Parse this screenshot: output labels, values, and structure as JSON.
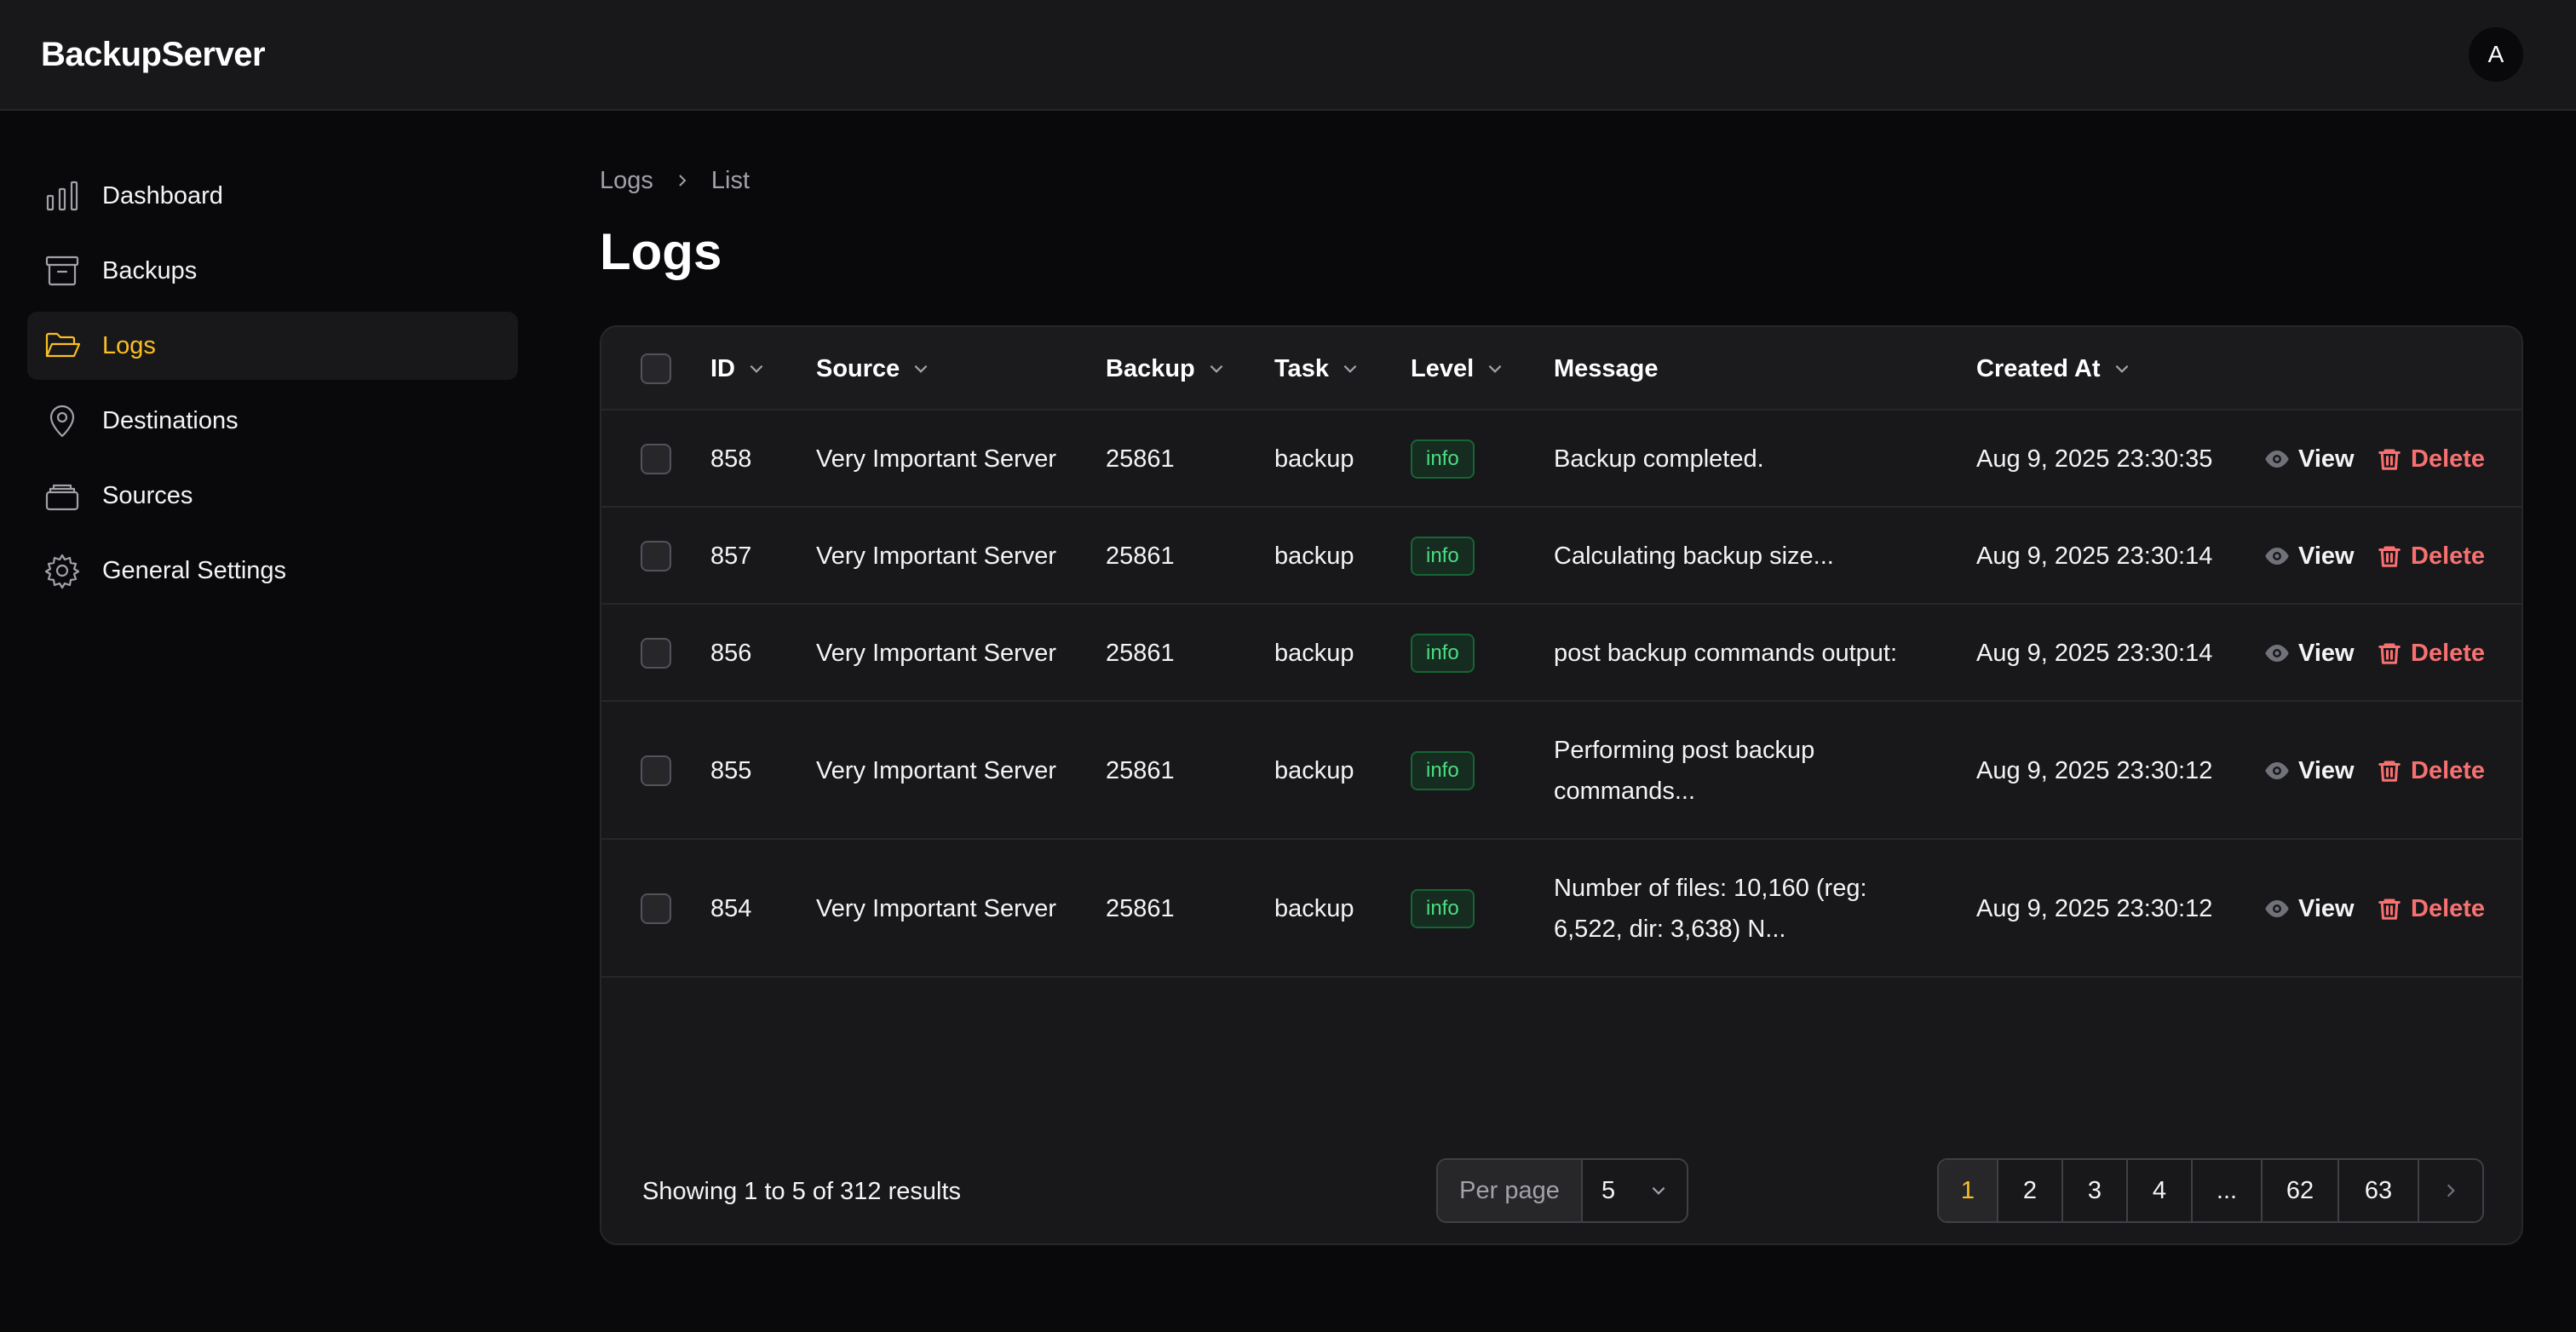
{
  "app": {
    "brand": "BackupServer",
    "avatar_initial": "A"
  },
  "sidebar": {
    "items": [
      {
        "label": "Dashboard",
        "icon": "bar-chart-icon",
        "active": false
      },
      {
        "label": "Backups",
        "icon": "archive-icon",
        "active": false
      },
      {
        "label": "Logs",
        "icon": "folder-open-icon",
        "active": true
      },
      {
        "label": "Destinations",
        "icon": "map-pin-icon",
        "active": false
      },
      {
        "label": "Sources",
        "icon": "stack-icon",
        "active": false
      },
      {
        "label": "General Settings",
        "icon": "gear-icon",
        "active": false
      }
    ]
  },
  "breadcrumb": {
    "parent": "Logs",
    "current": "List"
  },
  "page": {
    "title": "Logs"
  },
  "table": {
    "columns": {
      "id": "ID",
      "source": "Source",
      "backup": "Backup",
      "task": "Task",
      "level": "Level",
      "message": "Message",
      "created_at": "Created At"
    },
    "actions": {
      "view": "View",
      "delete": "Delete"
    },
    "rows": [
      {
        "id": "858",
        "source": "Very Important Server",
        "backup": "25861",
        "task": "backup",
        "level": "info",
        "message_lines": [
          "Backup completed."
        ],
        "created_at": "Aug 9, 2025 23:30:35"
      },
      {
        "id": "857",
        "source": "Very Important Server",
        "backup": "25861",
        "task": "backup",
        "level": "info",
        "message_lines": [
          "Calculating backup size..."
        ],
        "created_at": "Aug 9, 2025 23:30:14"
      },
      {
        "id": "856",
        "source": "Very Important Server",
        "backup": "25861",
        "task": "backup",
        "level": "info",
        "message_lines": [
          "post backup commands output:"
        ],
        "created_at": "Aug 9, 2025 23:30:14"
      },
      {
        "id": "855",
        "source": "Very Important Server",
        "backup": "25861",
        "task": "backup",
        "level": "info",
        "message_lines": [
          "Performing post backup",
          "commands..."
        ],
        "created_at": "Aug 9, 2025 23:30:12"
      },
      {
        "id": "854",
        "source": "Very Important Server",
        "backup": "25861",
        "task": "backup",
        "level": "info",
        "message_lines": [
          "Number of files: 10,160 (reg:",
          "6,522, dir: 3,638) N..."
        ],
        "created_at": "Aug 9, 2025 23:30:12"
      }
    ]
  },
  "footer": {
    "showing": "Showing 1 to 5 of 312 results",
    "per_page_label": "Per page",
    "per_page_value": "5",
    "pages": [
      "1",
      "2",
      "3",
      "4",
      "...",
      "62",
      "63"
    ],
    "current_page": "1"
  },
  "colors": {
    "accent": "#fbbf24",
    "danger": "#f87171",
    "info": "#4ade80",
    "background": "#09090b",
    "surface": "#18181b"
  }
}
